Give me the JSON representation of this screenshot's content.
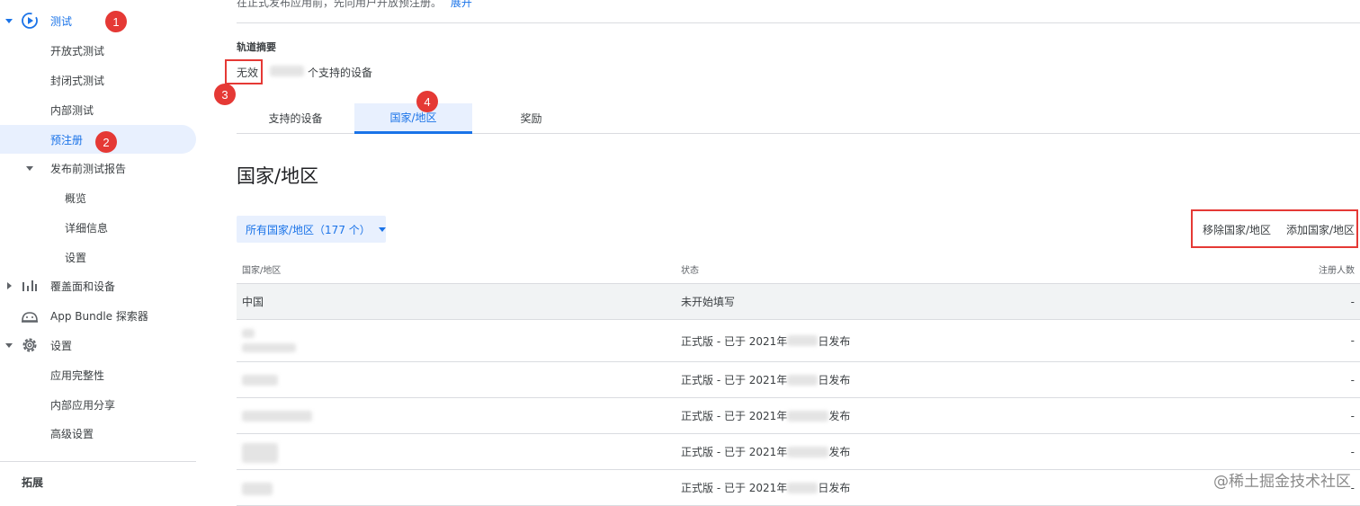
{
  "sidebar": {
    "testing": "测试",
    "open_testing": "开放式测试",
    "closed_testing": "封闭式测试",
    "internal_testing": "内部测试",
    "pre_registration": "预注册",
    "pre_launch_report": "发布前测试报告",
    "overview": "概览",
    "details": "详细信息",
    "settings_sub": "设置",
    "reach_devices": "覆盖面和设备",
    "bundle_explorer": "App Bundle 探索器",
    "settings": "设置",
    "app_integrity": "应用完整性",
    "internal_sharing": "内部应用分享",
    "advanced_settings": "高级设置",
    "extensions": "拓展"
  },
  "annotations": [
    "1",
    "2",
    "3",
    "4"
  ],
  "main": {
    "top_text": "在正式发布应用前，先向用户开放预注册。",
    "expand_link": "展开",
    "track_summary_label": "轨道摘要",
    "status_invalid": "无效",
    "devices_suffix": "个支持的设备",
    "tabs": [
      "支持的设备",
      "国家/地区",
      "奖励"
    ],
    "section_title": "国家/地区",
    "filter_button": "所有国家/地区（177 个）",
    "remove_button": "移除国家/地区",
    "add_button": "添加国家/地区",
    "table": {
      "headers": [
        "国家/地区",
        "状态",
        "注册人数"
      ],
      "rows": [
        {
          "country": "中国",
          "status": "未开始填写",
          "count": "-"
        },
        {
          "country": "",
          "status": "正式版 - 已于 2021年",
          "status_tail": "日发布",
          "count": "-"
        },
        {
          "country": "",
          "status": "正式版 - 已于 2021年",
          "status_tail": "日发布",
          "count": "-"
        },
        {
          "country": "",
          "status": "正式版 - 已于 2021年",
          "status_tail": "发布",
          "count": "-"
        },
        {
          "country": "",
          "status": "正式版 - 已于 2021年",
          "status_tail": "发布",
          "count": "-"
        },
        {
          "country": "",
          "status": "正式版 - 已于 2021年",
          "status_tail": "日发布",
          "count": "-"
        }
      ]
    },
    "watermark": "@稀土掘金技术社区"
  },
  "colors": {
    "accent": "#1a73e8",
    "annotation": "#e53935",
    "selected_bg": "#e8f0fe"
  }
}
